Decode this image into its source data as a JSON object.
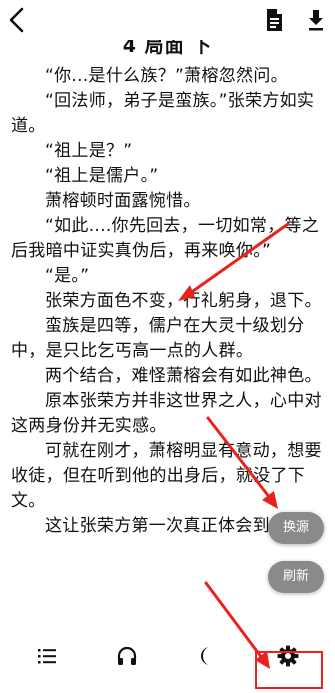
{
  "reader": {
    "chapter_title": "4 局面 下",
    "paragraphs": [
      "“你...是什么族？”萧榕忽然问。",
      "“回法师，弟子是蛮族。”张荣方如实道。",
      "“祖上是？”",
      "“祖上是儒户。”",
      "萧榕顿时面露惋惜。",
      "“如此....你先回去，一切如常，等之后我暗中证实真伪后，再来唤你。”",
      "“是。”",
      "张荣方面色不变，行礼躬身，退下。",
      "蛮族是四等，儒户在大灵十级划分中，是只比乞丐高一点的人群。",
      "两个结合，难怪萧榕会有如此神色。",
      "原本张荣方并非这世界之人，心中对这两身份并无实感。",
      "可就在刚才，萧榕明显有意动，想要收徒，但在听到他的出身后，就没了下文。",
      "这让张荣方第一次真正体会到"
    ]
  },
  "float_buttons": {
    "switch_source": "换源",
    "refresh": "刷新"
  },
  "icons": {
    "back": "back-arrow-icon",
    "document": "document-icon",
    "download": "download-icon",
    "toc": "list-icon",
    "listen": "headphones-icon",
    "night": "moon-icon",
    "settings": "gear-icon"
  },
  "colors": {
    "annotation": "#e8231e",
    "float_button": "#8a8a8a"
  }
}
